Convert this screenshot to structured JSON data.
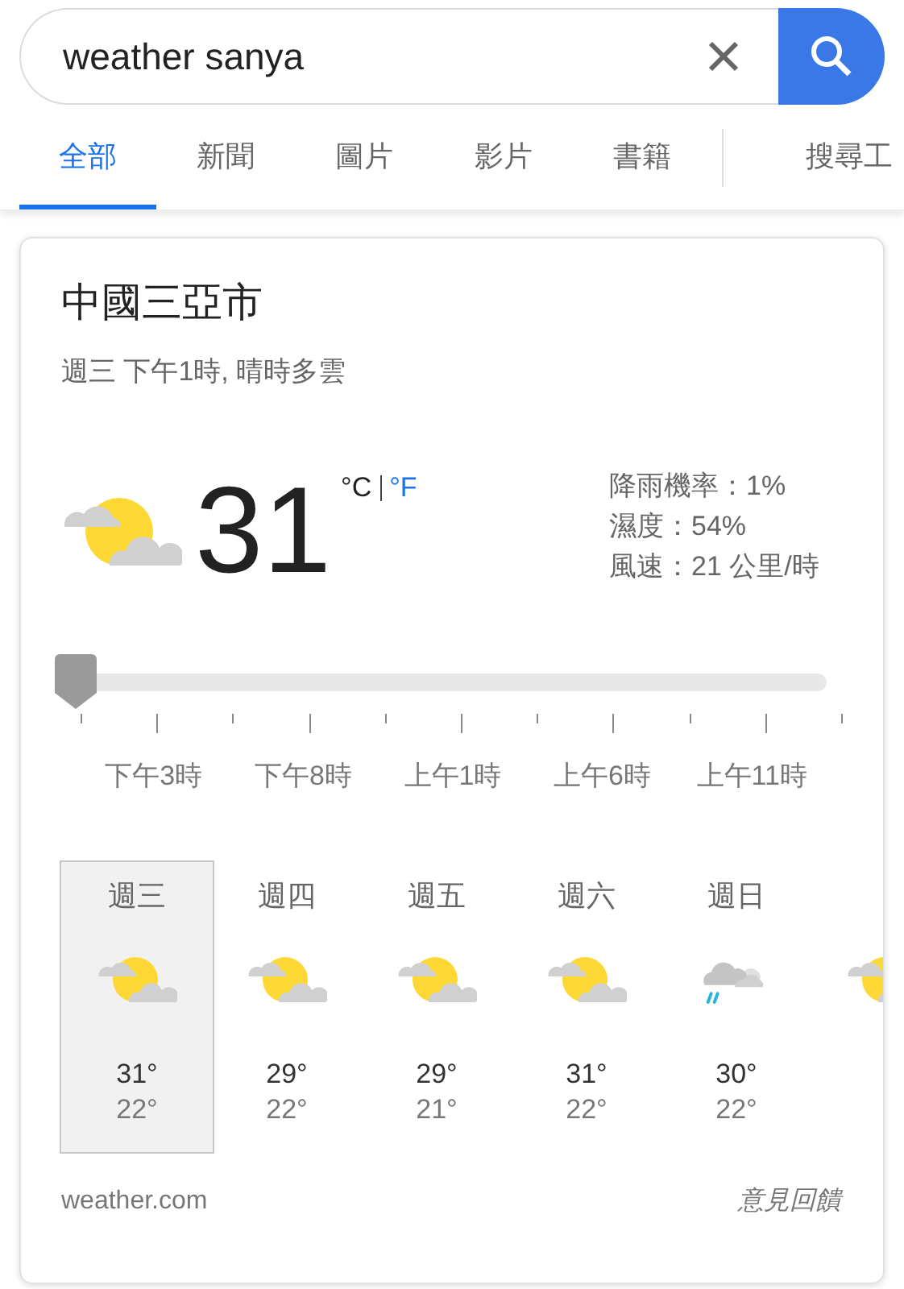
{
  "search": {
    "value": "weather sanya"
  },
  "tabs": [
    {
      "label": "全部",
      "selected": true
    },
    {
      "label": "新聞",
      "selected": false
    },
    {
      "label": "圖片",
      "selected": false
    },
    {
      "label": "影片",
      "selected": false
    },
    {
      "label": "書籍",
      "selected": false
    },
    {
      "label": "搜尋工",
      "selected": false
    }
  ],
  "weather": {
    "location": "中國三亞市",
    "subtitle": "週三 下午1時, 晴時多雲",
    "condition": {
      "kind": "partly_cloudy"
    },
    "temperature": "31",
    "units": [
      {
        "label": "°C",
        "selected": true
      },
      {
        "label": "°F",
        "selected": false
      }
    ],
    "details": [
      "降雨機率：1%",
      "濕度：54%",
      "風速：21 公里/時"
    ],
    "slider": {
      "level": 0,
      "labels": [
        "下午3時",
        "下午8時",
        "上午1時",
        "上午6時",
        "上午11時"
      ]
    },
    "days": [
      {
        "day": "週三",
        "kind": "partly_cloudy",
        "high": "31°",
        "low": "22°",
        "selected": true
      },
      {
        "day": "週四",
        "kind": "partly_cloudy",
        "high": "29°",
        "low": "22°",
        "selected": false
      },
      {
        "day": "週五",
        "kind": "partly_cloudy",
        "high": "29°",
        "low": "21°",
        "selected": false
      },
      {
        "day": "週六",
        "kind": "partly_cloudy",
        "high": "31°",
        "low": "22°",
        "selected": false
      },
      {
        "day": "週日",
        "kind": "rain",
        "high": "30°",
        "low": "22°",
        "selected": false
      },
      {
        "kind": "partly_cloudy",
        "selected": false
      }
    ],
    "source": "weather.com",
    "feedback": "意見回饋"
  }
}
